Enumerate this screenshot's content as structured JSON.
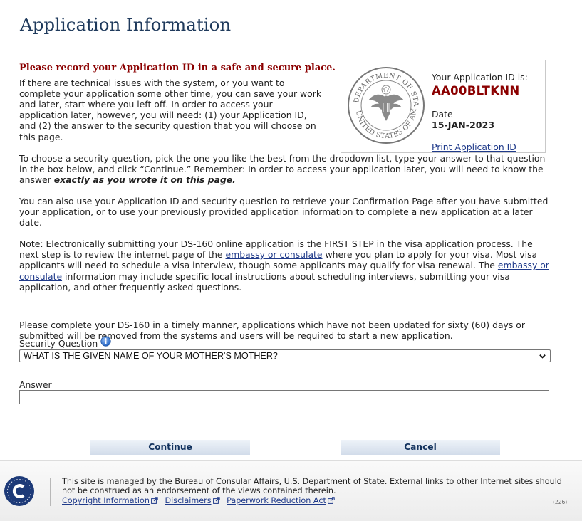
{
  "page": {
    "title": "Application Information"
  },
  "intro": {
    "heading": "Please record your Application ID in a safe and secure place.",
    "para1": "If there are technical issues with the system, or you want to complete your application some other time, you can save your work and later, start where you left off. In order to access your application later, however, you will need: (1) your Application ID, and (2) the answer to the security question that you will choose on this page.",
    "para2_a": "To choose a security question, pick the one you like the best from the dropdown list, type your answer to that question in the box below, and click “Continue.” Remember: In order to access your application later, you will need to know the answer",
    "para2_em": "exactly as you wrote it on this page.",
    "para3": "You can also use your Application ID and security question to retrieve your Confirmation Page after you have submitted your application, or to use your previously provided application information to complete a new application at a later date.",
    "para4_a": "Note: Electronically submitting your DS-160 online application is the FIRST STEP in the visa application process. The next step is to review the internet page of the",
    "embassy_link": "embassy or consulate",
    "para4_b": "where you plan to apply for your visa. Most visa applicants will need to schedule a visa interview, though some applicants may qualify for visa renewal. The",
    "embassy_link2": "embassy or consulate",
    "para4_c": "information may include specific local instructions about scheduling interviews, submitting your visa application, and other frequently asked questions.",
    "para5": "Please complete your DS-160 in a timely manner, applications which have not been updated for sixty (60) days or submitted will be removed from the systems and users will be required to start a new application."
  },
  "application": {
    "id_label": "Your Application ID is:",
    "id_value": "AA00BLTKNN",
    "date_label": "Date",
    "date_value": "15-JAN-2023",
    "print_link": "Print Application ID",
    "seal_icon": "department-of-state-seal-icon"
  },
  "form": {
    "security_question_label": "Security Question",
    "security_question_value": "WHAT IS THE GIVEN NAME OF YOUR MOTHER'S MOTHER?",
    "answer_label": "Answer",
    "answer_value": "",
    "info_icon": "info-icon"
  },
  "buttons": {
    "continue": "Continue",
    "cancel": "Cancel"
  },
  "footer": {
    "text": "This site is managed by the Bureau of Consular Affairs, U.S. Department of State. External links to other Internet sites should not be construed as an endorsement of the views contained therein.",
    "links": [
      "Copyright Information",
      "Disclaimers",
      "Paperwork Reduction Act"
    ],
    "version": "(226)",
    "logo_icon": "consular-affairs-logo-icon",
    "external_icon": "external-link-icon"
  },
  "colors": {
    "heading_red": "#8b0000",
    "title_blue": "#1f3a5c",
    "link_blue": "#1f3a8a",
    "button_text": "#12325e"
  }
}
